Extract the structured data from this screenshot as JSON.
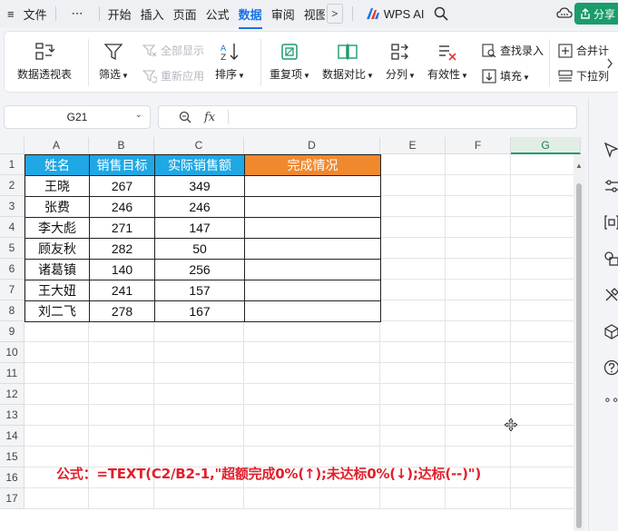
{
  "menubar": {
    "menu_icon": "≡",
    "file": "文件",
    "more": "⋯",
    "tabs": [
      "开始",
      "插入",
      "页面",
      "公式",
      "数据",
      "审阅",
      "视图"
    ],
    "active_tab": "数据",
    "scroll_arrow": ">",
    "wps_ai": "WPS AI",
    "share": "分享",
    "accent_color": "#1a73e8"
  },
  "ribbon": {
    "pivot": "数据透视表",
    "filter": "筛选",
    "show_all": "全部显示",
    "reapply": "重新应用",
    "sort": "排序",
    "duplicates": "重复项",
    "compare": "数据对比",
    "split": "分列",
    "validity": "有效性",
    "find_entry": "查找录入",
    "fill": "填充",
    "merge": "合并计",
    "dropdown": "下拉列"
  },
  "formula_bar": {
    "cell_ref": "G21",
    "zoom_icon": "search-icon",
    "fx": "fx",
    "content": ""
  },
  "sheet": {
    "columns": [
      "A",
      "B",
      "C",
      "D",
      "E",
      "F",
      "G"
    ],
    "selected_column": "G",
    "rows": [
      "1",
      "2",
      "3",
      "4",
      "5",
      "6",
      "7",
      "8",
      "9",
      "10",
      "11",
      "12",
      "13",
      "14",
      "15",
      "16",
      "17"
    ],
    "header": [
      "姓名",
      "销售目标",
      "实际销售额",
      "完成情况"
    ],
    "header_colors": [
      "#1fa8e3",
      "#1fa8e3",
      "#1fa8e3",
      "#f0882e"
    ],
    "data": [
      [
        "王晓",
        "267",
        "349",
        ""
      ],
      [
        "张费",
        "246",
        "246",
        ""
      ],
      [
        "李大彪",
        "271",
        "147",
        ""
      ],
      [
        "顾友秋",
        "282",
        "50",
        ""
      ],
      [
        "诸葛镇",
        "140",
        "256",
        ""
      ],
      [
        "王大妞",
        "241",
        "157",
        ""
      ],
      [
        "刘二飞",
        "278",
        "167",
        ""
      ]
    ],
    "annotation": "公式：=TEXT(C2/B2-1,\"超额完成0%(↑);未达标0%(↓);达标(--)\")",
    "annotation_color": "#e0202b"
  }
}
